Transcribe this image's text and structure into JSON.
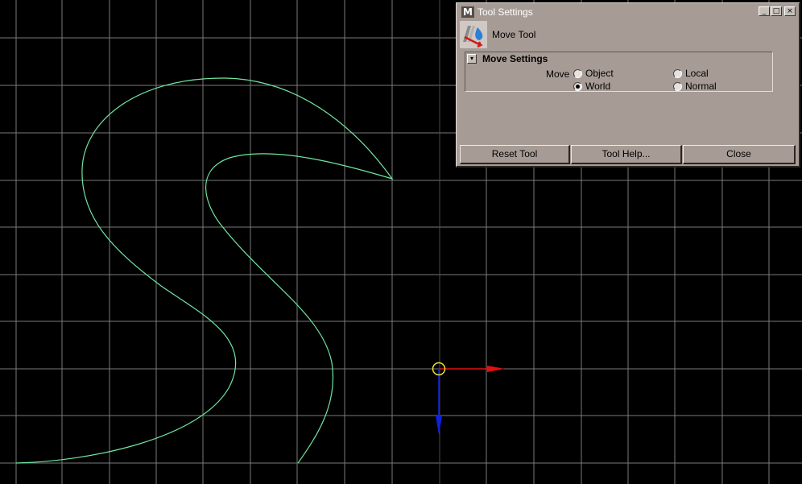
{
  "window": {
    "title": "Tool Settings",
    "app_icon": "maya-logo-icon",
    "controls": {
      "minimize": "_",
      "maximize": "□",
      "close": "×"
    }
  },
  "tool": {
    "name": "Move Tool",
    "icon": "move-tool-icon"
  },
  "move_settings": {
    "title": "Move Settings",
    "collapse_glyph": "▾",
    "move_label": "Move",
    "options": [
      {
        "label": "Object",
        "selected": false
      },
      {
        "label": "Local",
        "selected": false
      },
      {
        "label": "World",
        "selected": true
      },
      {
        "label": "Normal",
        "selected": false
      }
    ]
  },
  "buttons": {
    "reset": "Reset Tool",
    "help": "Tool Help...",
    "close": "Close"
  },
  "colors": {
    "viewport_bg": "#000000",
    "grid": "#7a7a7a",
    "curve": "#70e6a0",
    "manip_x": "#e01010",
    "manip_y": "#1020e0",
    "manip_center": "#e8e040",
    "panel_bg": "#a79c95"
  }
}
